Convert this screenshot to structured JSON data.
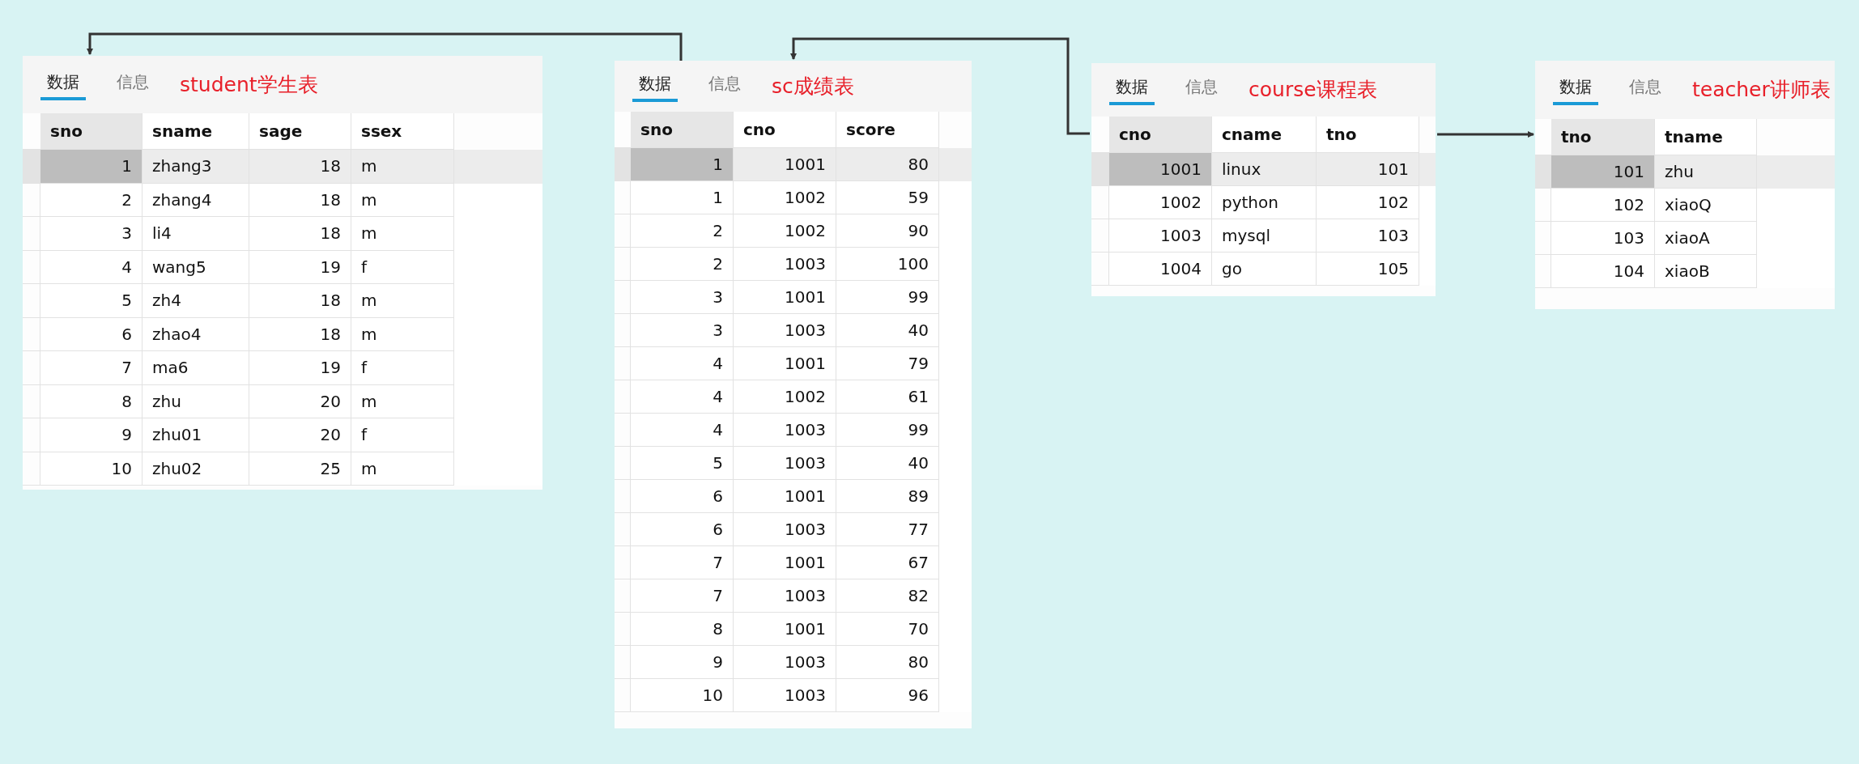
{
  "tables": [
    {
      "tabs": [
        {
          "label": "数据",
          "selected": true
        },
        {
          "label": "信息",
          "selected": false
        }
      ],
      "title": "student学生表",
      "columns": [
        "sno",
        "sname",
        "sage",
        "ssex"
      ],
      "rows": [
        {
          "selected": true,
          "cells": [
            "1",
            "zhang3",
            "18",
            "m"
          ]
        },
        {
          "selected": false,
          "cells": [
            "2",
            "zhang4",
            "18",
            "m"
          ]
        },
        {
          "selected": false,
          "cells": [
            "3",
            "li4",
            "18",
            "m"
          ]
        },
        {
          "selected": false,
          "cells": [
            "4",
            "wang5",
            "19",
            "f"
          ]
        },
        {
          "selected": false,
          "cells": [
            "5",
            "zh4",
            "18",
            "m"
          ]
        },
        {
          "selected": false,
          "cells": [
            "6",
            "zhao4",
            "18",
            "m"
          ]
        },
        {
          "selected": false,
          "cells": [
            "7",
            "ma6",
            "19",
            "f"
          ]
        },
        {
          "selected": false,
          "cells": [
            "8",
            "zhu",
            "20",
            "m"
          ]
        },
        {
          "selected": false,
          "cells": [
            "9",
            "zhu01",
            "20",
            "f"
          ]
        },
        {
          "selected": false,
          "cells": [
            "10",
            "zhu02",
            "25",
            "m"
          ]
        }
      ]
    },
    {
      "tabs": [
        {
          "label": "数据",
          "selected": true
        },
        {
          "label": "信息",
          "selected": false
        }
      ],
      "title": "sc成绩表",
      "columns": [
        "sno",
        "cno",
        "score"
      ],
      "rows": [
        {
          "selected": true,
          "cells": [
            "1",
            "1001",
            "80"
          ]
        },
        {
          "selected": false,
          "cells": [
            "1",
            "1002",
            "59"
          ]
        },
        {
          "selected": false,
          "cells": [
            "2",
            "1002",
            "90"
          ]
        },
        {
          "selected": false,
          "cells": [
            "2",
            "1003",
            "100"
          ]
        },
        {
          "selected": false,
          "cells": [
            "3",
            "1001",
            "99"
          ]
        },
        {
          "selected": false,
          "cells": [
            "3",
            "1003",
            "40"
          ]
        },
        {
          "selected": false,
          "cells": [
            "4",
            "1001",
            "79"
          ]
        },
        {
          "selected": false,
          "cells": [
            "4",
            "1002",
            "61"
          ]
        },
        {
          "selected": false,
          "cells": [
            "4",
            "1003",
            "99"
          ]
        },
        {
          "selected": false,
          "cells": [
            "5",
            "1003",
            "40"
          ]
        },
        {
          "selected": false,
          "cells": [
            "6",
            "1001",
            "89"
          ]
        },
        {
          "selected": false,
          "cells": [
            "6",
            "1003",
            "77"
          ]
        },
        {
          "selected": false,
          "cells": [
            "7",
            "1001",
            "67"
          ]
        },
        {
          "selected": false,
          "cells": [
            "7",
            "1003",
            "82"
          ]
        },
        {
          "selected": false,
          "cells": [
            "8",
            "1001",
            "70"
          ]
        },
        {
          "selected": false,
          "cells": [
            "9",
            "1003",
            "80"
          ]
        },
        {
          "selected": false,
          "cells": [
            "10",
            "1003",
            "96"
          ]
        }
      ]
    },
    {
      "tabs": [
        {
          "label": "数据",
          "selected": true
        },
        {
          "label": "信息",
          "selected": false
        }
      ],
      "title": "course课程表",
      "columns": [
        "cno",
        "cname",
        "tno"
      ],
      "rows": [
        {
          "selected": true,
          "cells": [
            "1001",
            "linux",
            "101"
          ]
        },
        {
          "selected": false,
          "cells": [
            "1002",
            "python",
            "102"
          ]
        },
        {
          "selected": false,
          "cells": [
            "1003",
            "mysql",
            "103"
          ]
        },
        {
          "selected": false,
          "cells": [
            "1004",
            "go",
            "105"
          ]
        }
      ]
    },
    {
      "tabs": [
        {
          "label": "数据",
          "selected": true
        },
        {
          "label": "信息",
          "selected": false
        }
      ],
      "title": "teacher讲师表",
      "columns": [
        "tno",
        "tname"
      ],
      "rows": [
        {
          "selected": true,
          "cells": [
            "101",
            "zhu"
          ]
        },
        {
          "selected": false,
          "cells": [
            "102",
            "xiaoQ"
          ]
        },
        {
          "selected": false,
          "cells": [
            "103",
            "xiaoA"
          ]
        },
        {
          "selected": false,
          "cells": [
            "104",
            "xiaoB"
          ]
        }
      ]
    }
  ]
}
